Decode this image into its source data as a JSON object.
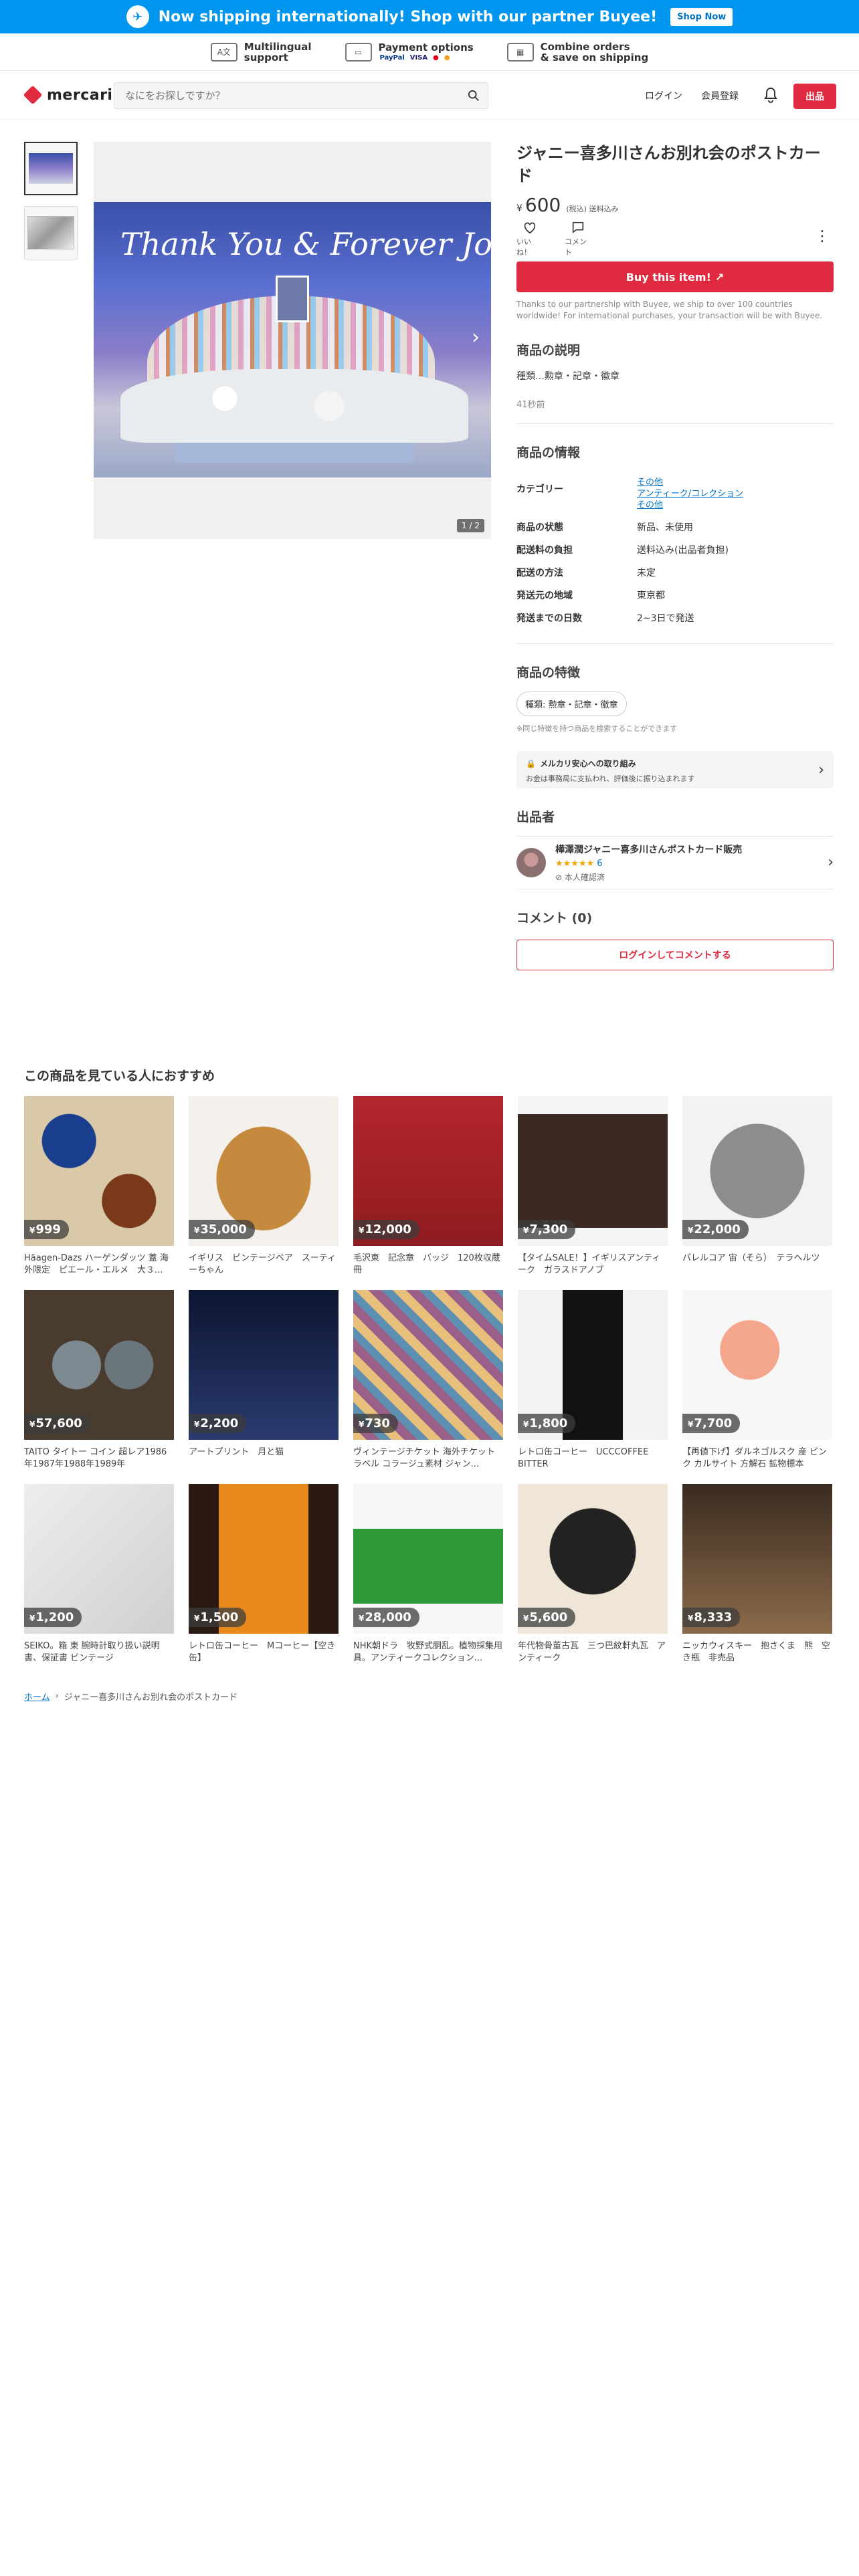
{
  "promo": {
    "text": "Now shipping internationally! Shop with our partner Buyee!",
    "button": "Shop Now"
  },
  "features": [
    {
      "line1": "Multilingual",
      "line2": "support"
    },
    {
      "line1": "Payment options",
      "logos": [
        "PayPal",
        "VISA"
      ]
    },
    {
      "line1": "Combine orders",
      "line2": "& save on shipping"
    }
  ],
  "header": {
    "logo": "mercari",
    "search_placeholder": "なにをお探しですか？",
    "login": "ログイン",
    "register": "会員登録",
    "sell": "出品"
  },
  "item": {
    "title": "ジャニー喜多川さんお別れ会のポストカード",
    "price_yen": "¥",
    "price": "600",
    "price_note": "(税込) 送料込み",
    "photo_text": "Thank You & Forever Johnny",
    "image_counter": "1 / 2",
    "like": "いいね！",
    "comment": "コメント",
    "buy": "Buy this item!",
    "buyee_note": "Thanks to our partnership with Buyee, we ship to over 100 countries worldwide! For international purchases, your transaction will be with Buyee."
  },
  "description": {
    "heading": "商品の説明",
    "text": "種類…勲章・記章・徽章",
    "posted": "41秒前"
  },
  "info": {
    "heading": "商品の情報",
    "category_label": "カテゴリー",
    "categories": [
      "その他",
      "アンティーク/コレクション",
      "その他"
    ],
    "rows": [
      {
        "k": "商品の状態",
        "v": "新品、未使用"
      },
      {
        "k": "配送料の負担",
        "v": "送料込み(出品者負担)"
      },
      {
        "k": "配送の方法",
        "v": "未定"
      },
      {
        "k": "発送元の地域",
        "v": "東京都"
      },
      {
        "k": "発送までの日数",
        "v": "2~3日で発送"
      }
    ]
  },
  "features_section": {
    "heading": "商品の特徴",
    "chip": "種類: 勲章・記章・徽章",
    "note": "※同じ特徴を持つ商品を検索することができます"
  },
  "safety": {
    "title": "メルカリ安心への取り組み",
    "desc": "お金は事務局に支払われ、評価後に振り込まれます"
  },
  "seller": {
    "heading": "出品者",
    "name": "樺澤潤ジャニー喜多川さんポストカード販売",
    "stars": "★★★★★",
    "count": "6",
    "verified": "本人確認済"
  },
  "comments": {
    "heading": "コメント (0)",
    "login_button": "ログインしてコメントする"
  },
  "recommend": {
    "heading": "この商品を見ている人におすすめ",
    "items": [
      {
        "price": "999",
        "name": "Häagen-Dazs ハーゲンダッツ 蓋 海外限定　ピエール・エルメ　大３..."
      },
      {
        "price": "35,000",
        "name": "イギリス　ビンテージベア　スーティーちゃん"
      },
      {
        "price": "12,000",
        "name": "毛沢東　記念章　バッジ　120枚収蔵冊"
      },
      {
        "price": "7,300",
        "name": "【タイムSALE！】イギリスアンティーク　ガラスドアノブ"
      },
      {
        "price": "22,000",
        "name": "パレルコア 宙（そら）　テラヘルツ"
      },
      {
        "price": "57,600",
        "name": "TAITO タイトー コイン 超レア1986年1987年1988年1989年"
      },
      {
        "price": "2,200",
        "name": "アートプリント　月と猫"
      },
      {
        "price": "730",
        "name": "ヴィンテージチケット 海外チケット ラベル コラージュ素材 ジャン..."
      },
      {
        "price": "1,800",
        "name": "レトロ缶コーヒー　UCCCOFFEE BITTER"
      },
      {
        "price": "7,700",
        "name": "【再値下げ】ダルネゴルスク 産 ピンク カルサイト 方解石 鉱物標本"
      },
      {
        "price": "1,200",
        "name": "SEIKO。箱 東 腕時計取り扱い説明書、保証書 ビンテージ"
      },
      {
        "price": "1,500",
        "name": "レトロ缶コーヒー　Mコーヒー【空き缶】"
      },
      {
        "price": "28,000",
        "name": "NHK朝ドラ　牧野式胴乱。植物採集用具。アンティークコレクション..."
      },
      {
        "price": "5,600",
        "name": "年代物骨董古瓦　三つ巴紋軒丸瓦　アンティーク"
      },
      {
        "price": "8,333",
        "name": "ニッカウィスキー　抱さくま　熊　空き瓶　非売品"
      }
    ]
  },
  "breadcrumb": {
    "home": "ホーム",
    "current": "ジャニー喜多川さんお別れ会のポストカード"
  },
  "colors": {
    "primary": "#e02a3f",
    "promo": "#0095ee",
    "link": "#0073cc"
  }
}
